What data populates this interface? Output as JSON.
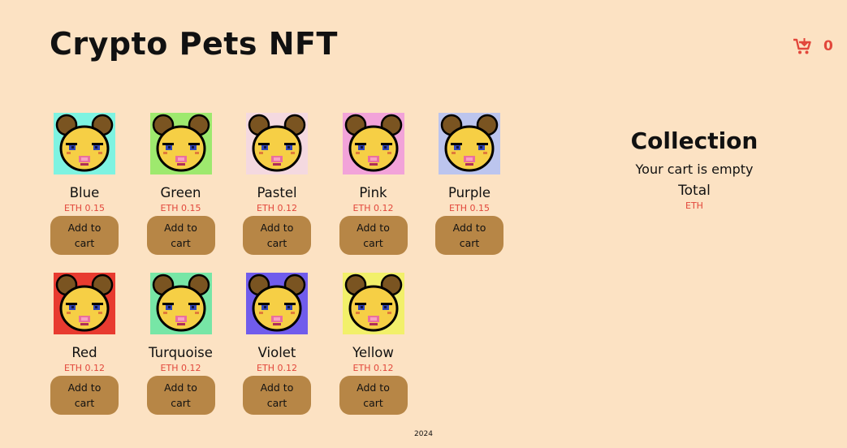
{
  "header": {
    "title": "Crypto Pets NFT",
    "cart_count": "0",
    "cart_icon": "cart-icon",
    "accent_color": "#e2473b"
  },
  "products": [
    {
      "name": "Blue",
      "price": "ETH 0.15",
      "button": "Add to cart",
      "bg": "#7ef3e1"
    },
    {
      "name": "Green",
      "price": "ETH 0.15",
      "button": "Add to cart",
      "bg": "#9ee96e"
    },
    {
      "name": "Pastel",
      "price": "ETH 0.12",
      "button": "Add to cart",
      "bg": "#f4d9e0"
    },
    {
      "name": "Pink",
      "price": "ETH 0.12",
      "button": "Add to cart",
      "bg": "#f2a3d9"
    },
    {
      "name": "Purple",
      "price": "ETH 0.15",
      "button": "Add to cart",
      "bg": "#bcc5ee"
    },
    {
      "name": "Red",
      "price": "ETH 0.12",
      "button": "Add to cart",
      "bg": "#e83b30"
    },
    {
      "name": "Turquoise",
      "price": "ETH 0.12",
      "button": "Add to cart",
      "bg": "#77e6a6"
    },
    {
      "name": "Violet",
      "price": "ETH 0.12",
      "button": "Add to cart",
      "bg": "#705cec"
    },
    {
      "name": "Yellow",
      "price": "ETH 0.12",
      "button": "Add to cart",
      "bg": "#f2f06a"
    }
  ],
  "collection": {
    "title": "Collection",
    "empty_message": "Your cart is empty",
    "total_label": "Total",
    "total_currency": "ETH"
  },
  "footer": {
    "year": "2024"
  }
}
